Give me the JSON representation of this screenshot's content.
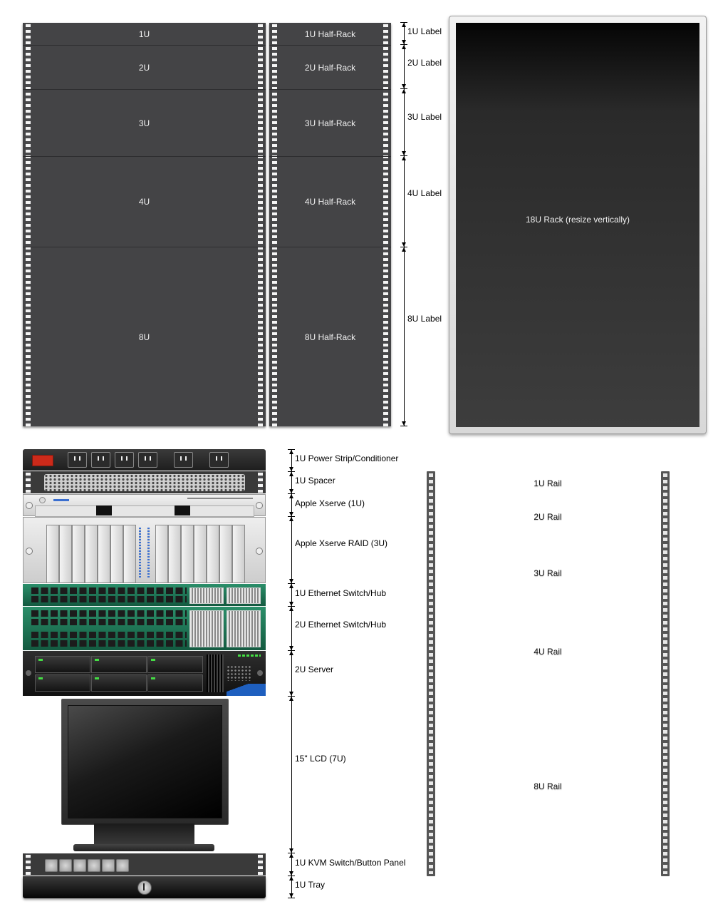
{
  "rack_units": [
    "1U",
    "2U",
    "3U",
    "4U",
    "8U"
  ],
  "half_racks": [
    "1U Half-Rack",
    "2U Half-Rack",
    "3U Half-Rack",
    "4U Half-Rack",
    "8U Half-Rack"
  ],
  "unit_labels": [
    "1U Label",
    "2U Label",
    "3U Label",
    "4U Label",
    "8U Label"
  ],
  "big_rack": {
    "label": "18U Rack (resize vertically)"
  },
  "devices": [
    "1U Power Strip/Conditioner",
    "1U Spacer",
    "Apple Xserve (1U)",
    "Apple Xserve RAID (3U)",
    "1U Ethernet Switch/Hub",
    "2U Ethernet Switch/Hub",
    "2U Server",
    "15\" LCD (7U)",
    "1U KVM Switch/Button Panel",
    "1U Tray"
  ],
  "rails": [
    "1U Rail",
    "2U Rail",
    "3U Rail",
    "4U Rail",
    "8U Rail"
  ],
  "colors": {
    "rack_panel": "#444446",
    "switch_green": "#1f7a5a",
    "power_red": "#cc2a1a",
    "led_green": "#44dd44"
  }
}
